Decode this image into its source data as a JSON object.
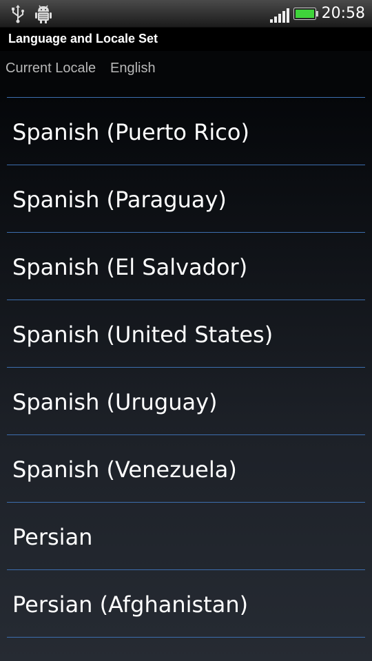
{
  "status_bar": {
    "time": "20:58",
    "icons": [
      "usb-icon",
      "android-debug-icon",
      "signal-icon",
      "battery-icon"
    ],
    "battery_color": "#3fd43b"
  },
  "header": {
    "title": "Language and Locale Set"
  },
  "current_locale": {
    "label": "Current Locale",
    "value": "English"
  },
  "list": {
    "items": [
      {
        "label": "Spanish (Puerto Rico)"
      },
      {
        "label": "Spanish (Paraguay)"
      },
      {
        "label": "Spanish (El Salvador)"
      },
      {
        "label": "Spanish (United States)"
      },
      {
        "label": "Spanish (Uruguay)"
      },
      {
        "label": "Spanish (Venezuela)"
      },
      {
        "label": "Persian"
      },
      {
        "label": "Persian (Afghanistan)"
      }
    ],
    "divider_color": "#3d6fb0"
  }
}
